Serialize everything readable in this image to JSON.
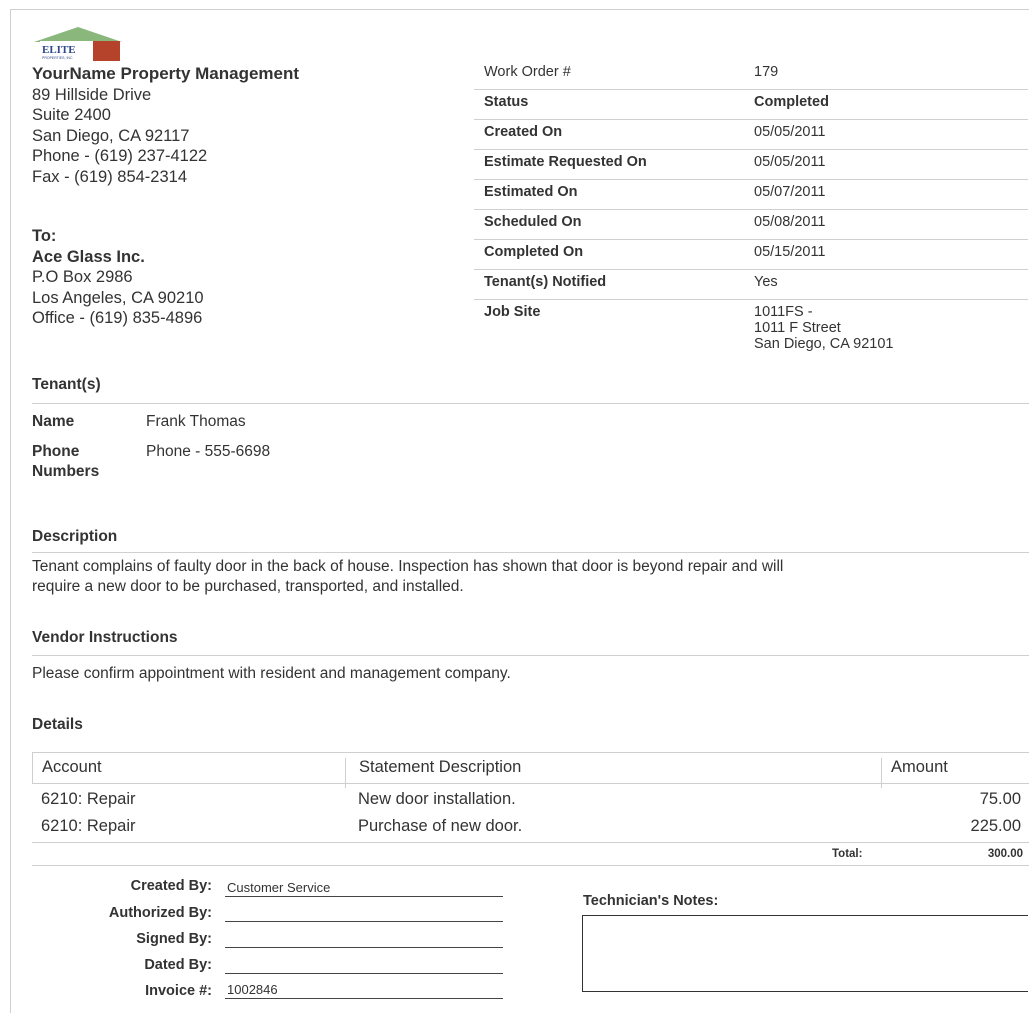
{
  "logo": {
    "text": "ELITE",
    "subtext": "PROPERTIES, INC",
    "colors": {
      "roof": "#8ab77c",
      "accent": "#b5432b",
      "text": "#2f4a8a"
    }
  },
  "company": {
    "name": "YourName Property Management",
    "address1": "89 Hillside Drive",
    "address2": "Suite 2400",
    "city": "San Diego, CA 92117",
    "phone": "Phone - (619) 237-4122",
    "fax": "Fax - (619) 854-2314"
  },
  "to": {
    "label": "To:",
    "name": "Ace Glass Inc.",
    "address1": "P.O Box 2986",
    "city": "Los Angeles, CA 90210",
    "office": "Office - (619) 835-4896"
  },
  "work_order": {
    "rows": [
      {
        "label": "Work Order #",
        "value": "179"
      },
      {
        "label": "Status",
        "value": "Completed"
      },
      {
        "label": "Created On",
        "value": "05/05/2011"
      },
      {
        "label": "Estimate Requested On",
        "value": "05/05/2011"
      },
      {
        "label": "Estimated On",
        "value": "05/07/2011"
      },
      {
        "label": "Scheduled On",
        "value": "05/08/2011"
      },
      {
        "label": "Completed On",
        "value": "05/15/2011"
      },
      {
        "label": "Tenant(s) Notified",
        "value": "Yes"
      }
    ],
    "job_site_label": "Job Site",
    "job_site_line1": "1011FS -",
    "job_site_line2": "1011 F Street",
    "job_site_line3": "San Diego, CA 92101"
  },
  "tenants": {
    "title": "Tenant(s)",
    "name_label": "Name",
    "name_value": "Frank Thomas",
    "phone_label_line1": "Phone",
    "phone_label_line2": "Numbers",
    "phone_value": "Phone - 555-6698"
  },
  "description": {
    "title": "Description",
    "line1": "Tenant complains of faulty door in the back of house. Inspection has shown that door is beyond repair and will",
    "line2": "require a new door to be purchased, transported, and installed."
  },
  "vendor_instructions": {
    "title": "Vendor Instructions",
    "text": "Please confirm appointment with resident and management company."
  },
  "details": {
    "title": "Details",
    "headers": {
      "account": "Account",
      "description": "Statement Description",
      "amount": "Amount"
    },
    "rows": [
      {
        "account": "6210: Repair",
        "description": "New door installation.",
        "amount": "75.00"
      },
      {
        "account": "6210: Repair",
        "description": "Purchase of new door.",
        "amount": "225.00"
      }
    ],
    "total_label": "Total:",
    "total_value": "300.00"
  },
  "signatures": {
    "created_by_label": "Created By:",
    "created_by_value": "Customer Service",
    "authorized_by_label": "Authorized By:",
    "signed_by_label": "Signed By:",
    "dated_by_label": "Dated By:",
    "invoice_label": "Invoice #:",
    "invoice_value": "1002846"
  },
  "technician_notes": {
    "label": "Technician's Notes:"
  }
}
